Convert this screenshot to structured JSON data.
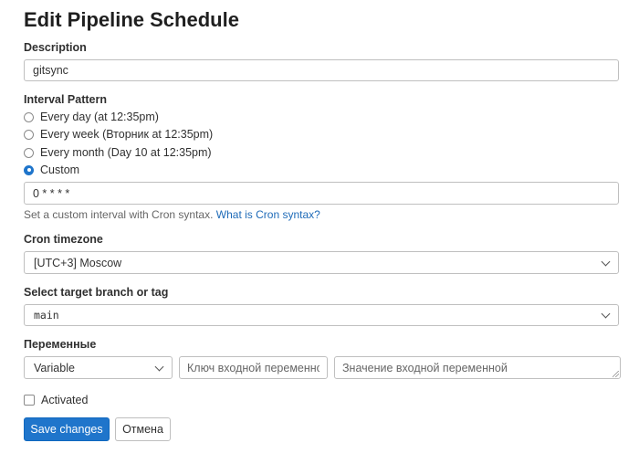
{
  "page": {
    "title": "Edit Pipeline Schedule"
  },
  "description": {
    "label": "Description",
    "value": "gitsync"
  },
  "interval": {
    "label": "Interval Pattern",
    "options": [
      {
        "label": "Every day (at 12:35pm)",
        "checked": false
      },
      {
        "label": "Every week (Вторник at 12:35pm)",
        "checked": false
      },
      {
        "label": "Every month (Day 10 at 12:35pm)",
        "checked": false
      },
      {
        "label": "Custom",
        "checked": true
      }
    ],
    "custom_value": "0 * * * *",
    "help_text": "Set a custom interval with Cron syntax.",
    "help_link": "What is Cron syntax?"
  },
  "timezone": {
    "label": "Cron timezone",
    "value": "[UTC+3] Moscow"
  },
  "branch": {
    "label": "Select target branch or tag",
    "value": "main"
  },
  "variables": {
    "label": "Переменные",
    "type_value": "Variable",
    "key_placeholder": "Ключ входной переменной",
    "value_placeholder": "Значение входной переменной"
  },
  "activated": {
    "label": "Activated",
    "checked": false
  },
  "actions": {
    "save_label": "Save changes",
    "cancel_label": "Отмена"
  },
  "colors": {
    "accent": "#1f75cb",
    "link": "#1f6bb8"
  }
}
